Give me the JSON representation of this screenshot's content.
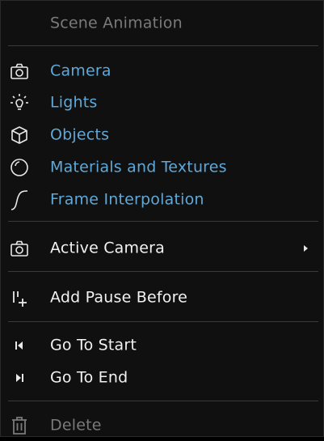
{
  "menu": {
    "header": "Scene Animation",
    "items": [
      {
        "label": "Camera",
        "icon": "camera-icon"
      },
      {
        "label": "Lights",
        "icon": "light-bulb-icon"
      },
      {
        "label": "Objects",
        "icon": "cube-icon"
      },
      {
        "label": "Materials and Textures",
        "icon": "material-sphere-icon"
      },
      {
        "label": "Frame Interpolation",
        "icon": "curve-icon"
      },
      {
        "label": "Active Camera",
        "icon": "camera-icon",
        "submenu": true
      },
      {
        "label": "Add Pause Before",
        "icon": "add-pause-icon"
      },
      {
        "label": "Go To Start",
        "icon": "skip-to-start-icon"
      },
      {
        "label": "Go To End",
        "icon": "skip-to-end-icon"
      },
      {
        "label": "Delete",
        "icon": "trash-icon",
        "disabled": true
      }
    ]
  },
  "colors": {
    "background": "#101010",
    "accent_blue": "#5fa8d8",
    "text": "#f2f2f2",
    "disabled": "#7a7a7a",
    "separator": "#3a3a3a"
  }
}
